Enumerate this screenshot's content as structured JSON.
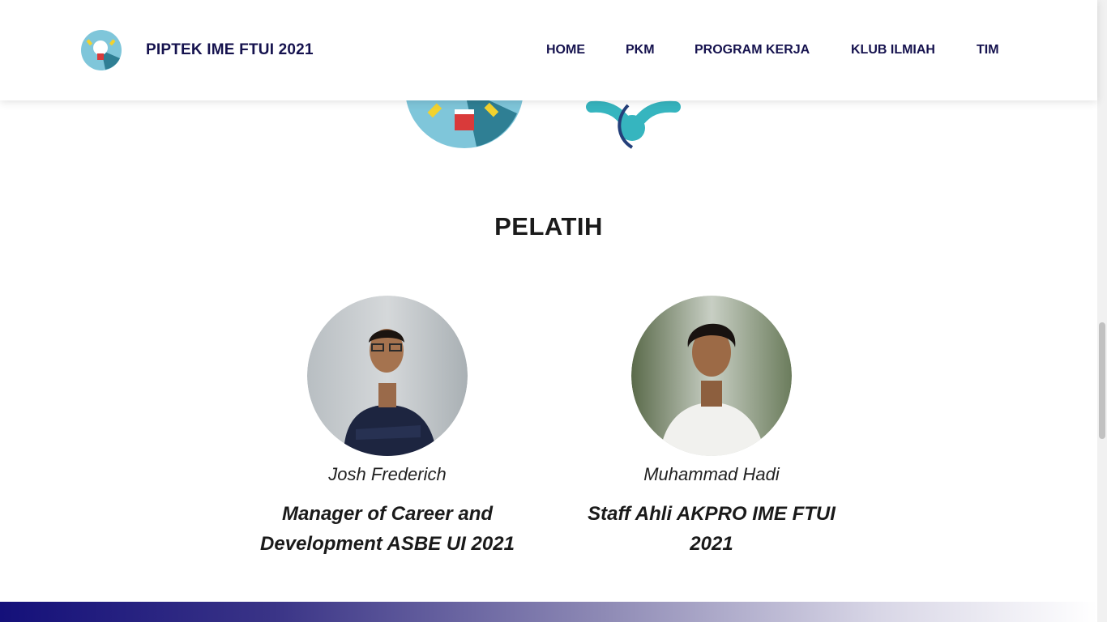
{
  "header": {
    "brand": "PIPTEK IME FTUI 2021",
    "nav": [
      {
        "label": "HOME"
      },
      {
        "label": "PKM"
      },
      {
        "label": "PROGRAM KERJA"
      },
      {
        "label": "KLUB ILMIAH"
      },
      {
        "label": "TIM"
      }
    ]
  },
  "section": {
    "title": "PELATIH",
    "coaches": [
      {
        "name": "Josh Frederich",
        "role": "Manager of Career and Development ASBE UI 2021"
      },
      {
        "name": "Muhammad Hadi",
        "role": "Staff Ahli AKPRO IME FTUI 2021"
      }
    ]
  },
  "icons": {
    "logo": "lightbulb-logo-icon",
    "partial_1": "lightbulb-circle-icon",
    "partial_2": "molecule-network-icon"
  },
  "colors": {
    "brand_navy": "#15124e",
    "footer_gradient_start": "#14107a",
    "accent_teal": "#2a9cad"
  }
}
